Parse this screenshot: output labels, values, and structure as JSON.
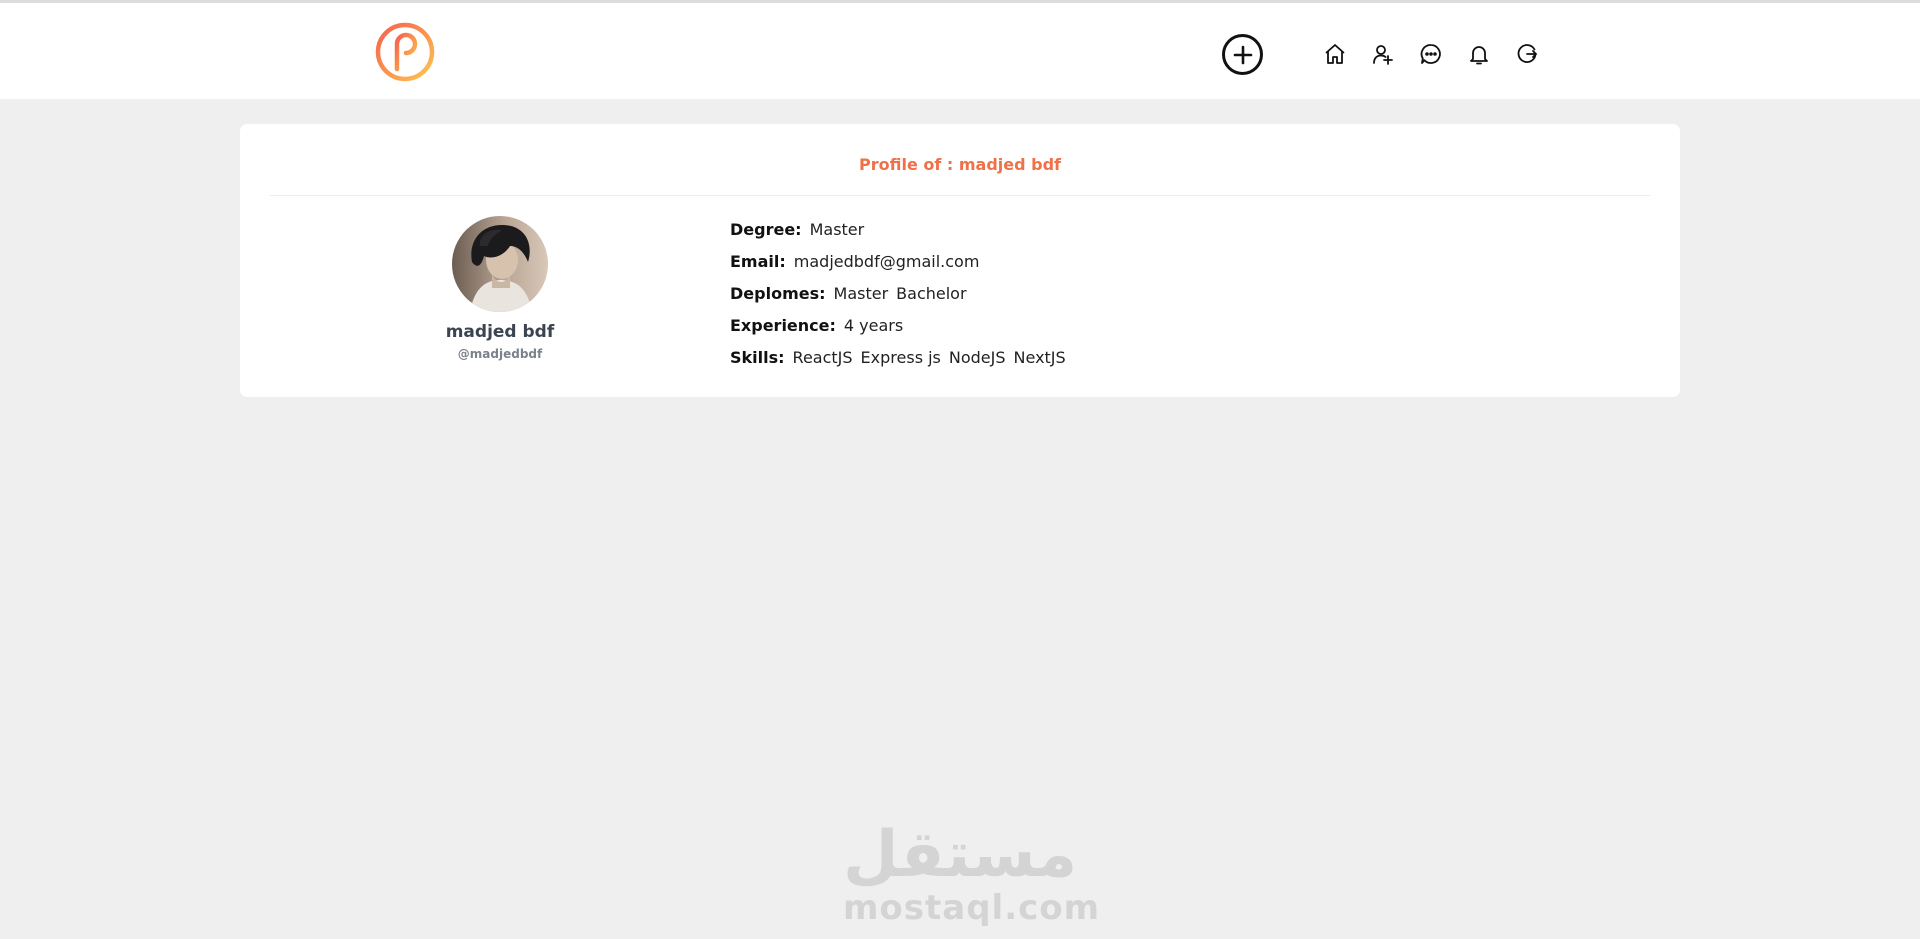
{
  "header": {
    "logo_icon": "p-logo-icon",
    "add_icon": "plus-circle-icon",
    "nav_icons": [
      "home-icon",
      "users-icon",
      "chat-icon",
      "bell-icon",
      "logout-icon"
    ]
  },
  "profile": {
    "title": "Profile of : madjed bdf",
    "name": "madjed bdf",
    "handle": "@madjedbdf",
    "details": {
      "degree_label": "Degree:",
      "degree_value": "Master",
      "email_label": "Email:",
      "email_value": "madjedbdf@gmail.com",
      "deplomes_label": "Deplomes:",
      "deplomes_values": [
        "Master",
        "Bachelor"
      ],
      "experience_label": "Experience:",
      "experience_value": "4 years",
      "skills_label": "Skills:",
      "skills_values": [
        "ReactJS",
        "Express js",
        "NodeJS",
        "NextJS"
      ]
    }
  },
  "watermark": {
    "arabic": "مستقل",
    "latin": "mostaql.com"
  },
  "colors": {
    "accent": "#f07048",
    "logo_gradient_start": "#f5614f",
    "logo_gradient_end": "#ffc44d"
  }
}
